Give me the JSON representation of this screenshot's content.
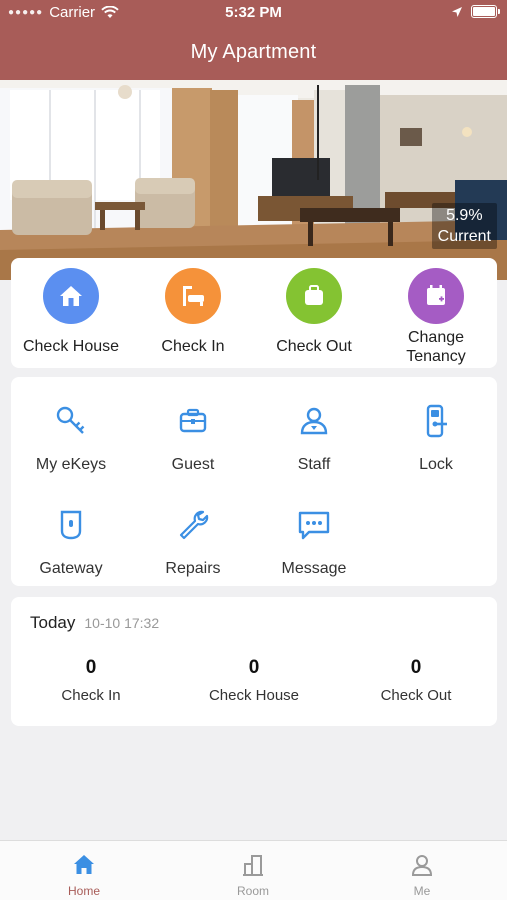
{
  "status_bar": {
    "carrier": "Carrier",
    "time": "5:32 PM"
  },
  "header": {
    "title": "My Apartment"
  },
  "banner": {
    "rate": "5.9%",
    "rate_label": "Current"
  },
  "quick_actions": [
    {
      "label": "Check House",
      "icon": "house-icon",
      "color": "#5b8ff0"
    },
    {
      "label": "Check In",
      "icon": "bed-icon",
      "color": "#f5923a"
    },
    {
      "label": "Check Out",
      "icon": "suitcase-icon",
      "color": "#84c332"
    },
    {
      "label": "Change Tenancy",
      "icon": "calendar-icon",
      "color": "#a55cc4"
    }
  ],
  "tools": [
    {
      "label": "My eKeys",
      "icon": "key-icon"
    },
    {
      "label": "Guest",
      "icon": "briefcase-icon"
    },
    {
      "label": "Staff",
      "icon": "user-icon"
    },
    {
      "label": "Lock",
      "icon": "lock-icon"
    },
    {
      "label": "Gateway",
      "icon": "gateway-icon"
    },
    {
      "label": "Repairs",
      "icon": "wrench-icon"
    },
    {
      "label": "Message",
      "icon": "message-icon"
    }
  ],
  "today": {
    "title": "Today",
    "datetime": "10-10 17:32",
    "stats": [
      {
        "value": "0",
        "label": "Check In"
      },
      {
        "value": "0",
        "label": "Check House"
      },
      {
        "value": "0",
        "label": "Check Out"
      }
    ]
  },
  "tabs": [
    {
      "label": "Home",
      "icon": "home-icon",
      "active": true
    },
    {
      "label": "Room",
      "icon": "building-icon",
      "active": false
    },
    {
      "label": "Me",
      "icon": "person-icon",
      "active": false
    }
  ],
  "colors": {
    "header": "#a85c58",
    "accent_blue": "#3b8fe3"
  }
}
